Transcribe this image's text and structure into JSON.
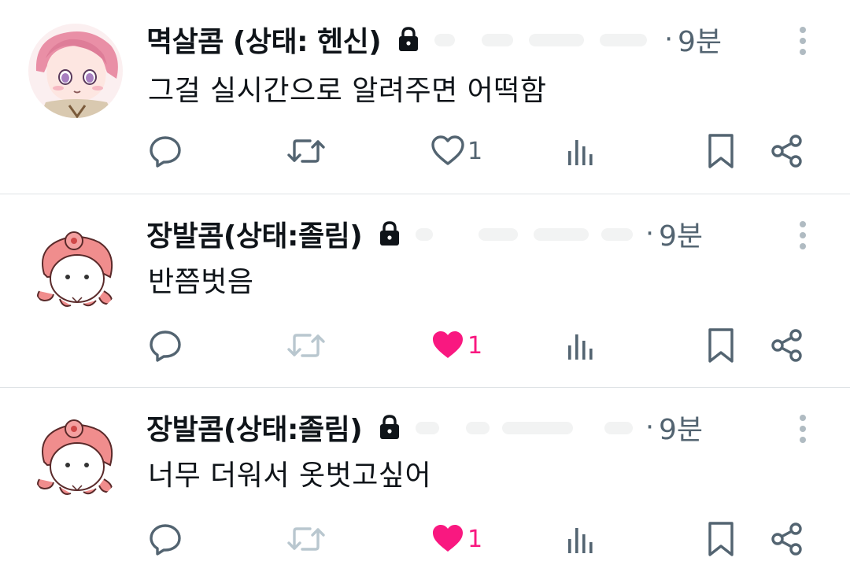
{
  "colors": {
    "text": "#0f1419",
    "muted": "#536471",
    "like_active": "#f91880",
    "retweet_disabled": "#b9c7cf",
    "divider": "#dfe3e6"
  },
  "tweets": [
    {
      "display_name": "멱살콤 (상태: 헨신)",
      "handle_hidden": true,
      "time": "9분",
      "text": "그걸 실시간으로 알려주면 어떡함",
      "likes": "1",
      "liked": false,
      "retweet_enabled": true,
      "avatar": "pink-haired-anime-avatar"
    },
    {
      "display_name": "장발콤(상태:졸림)",
      "handle_hidden": true,
      "time": "9분",
      "text": "반쯤벗음",
      "likes": "1",
      "liked": true,
      "retweet_enabled": false,
      "avatar": "pink-octopus-avatar"
    },
    {
      "display_name": "장발콤(상태:졸림)",
      "handle_hidden": true,
      "time": "9분",
      "text": "너무 더워서 옷벗고싶어",
      "likes": "1",
      "liked": true,
      "retweet_enabled": false,
      "avatar": "pink-octopus-avatar"
    }
  ],
  "icons": {
    "lock": "lock-icon",
    "more": "more-vertical-icon",
    "reply": "reply-icon",
    "retweet": "retweet-icon",
    "like": "heart-icon",
    "views": "views-icon",
    "bookmark": "bookmark-icon",
    "share": "share-icon"
  }
}
